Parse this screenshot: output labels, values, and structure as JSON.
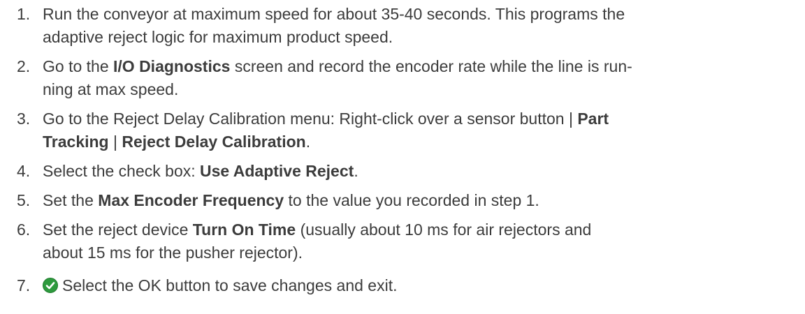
{
  "steps": [
    {
      "num": "1.",
      "parts": [
        {
          "text": "Run the conveyor at maximum speed for about 35-40 seconds. This programs the",
          "bold": false
        },
        {
          "br": true
        },
        {
          "text": "adaptive reject logic for maximum product speed.",
          "bold": false
        }
      ]
    },
    {
      "num": "2.",
      "parts": [
        {
          "text": "Go to the ",
          "bold": false
        },
        {
          "text": "I/O Diagnostics",
          "bold": true
        },
        {
          "text": " screen and record the encoder rate while the line is run-",
          "bold": false
        },
        {
          "br": true
        },
        {
          "text": "ning at max speed.",
          "bold": false
        }
      ]
    },
    {
      "num": "3.",
      "parts": [
        {
          "text": "Go to the Reject Delay Calibration menu: Right-click over a sensor button | ",
          "bold": false
        },
        {
          "text": "Part",
          "bold": true
        },
        {
          "br": true
        },
        {
          "text": "Tracking",
          "bold": true
        },
        {
          "text": " | ",
          "bold": false
        },
        {
          "text": "Reject Delay Calibration",
          "bold": true
        },
        {
          "text": ".",
          "bold": false
        }
      ]
    },
    {
      "num": "4.",
      "parts": [
        {
          "text": "Select the check box: ",
          "bold": false
        },
        {
          "text": "Use Adaptive Reject",
          "bold": true
        },
        {
          "text": ".",
          "bold": false
        }
      ]
    },
    {
      "num": "5.",
      "parts": [
        {
          "text": "Set the ",
          "bold": false
        },
        {
          "text": "Max Encoder Frequency",
          "bold": true
        },
        {
          "text": " to the value you recorded in step 1.",
          "bold": false
        }
      ]
    },
    {
      "num": "6.",
      "parts": [
        {
          "text": "Set the reject device ",
          "bold": false
        },
        {
          "text": "Turn On Time",
          "bold": true
        },
        {
          "text": " (usually about 10 ms for air rejectors and",
          "bold": false
        },
        {
          "br": true
        },
        {
          "text": "about 15 ms for the pusher rejector).",
          "bold": false
        }
      ]
    },
    {
      "num": "7.",
      "icon": "check-circle-icon",
      "parts": [
        {
          "text": "Select the OK button to save changes and exit.",
          "bold": false
        }
      ]
    }
  ],
  "colors": {
    "text": "#3c3c3c",
    "icon_green": "#2e9a3e"
  }
}
